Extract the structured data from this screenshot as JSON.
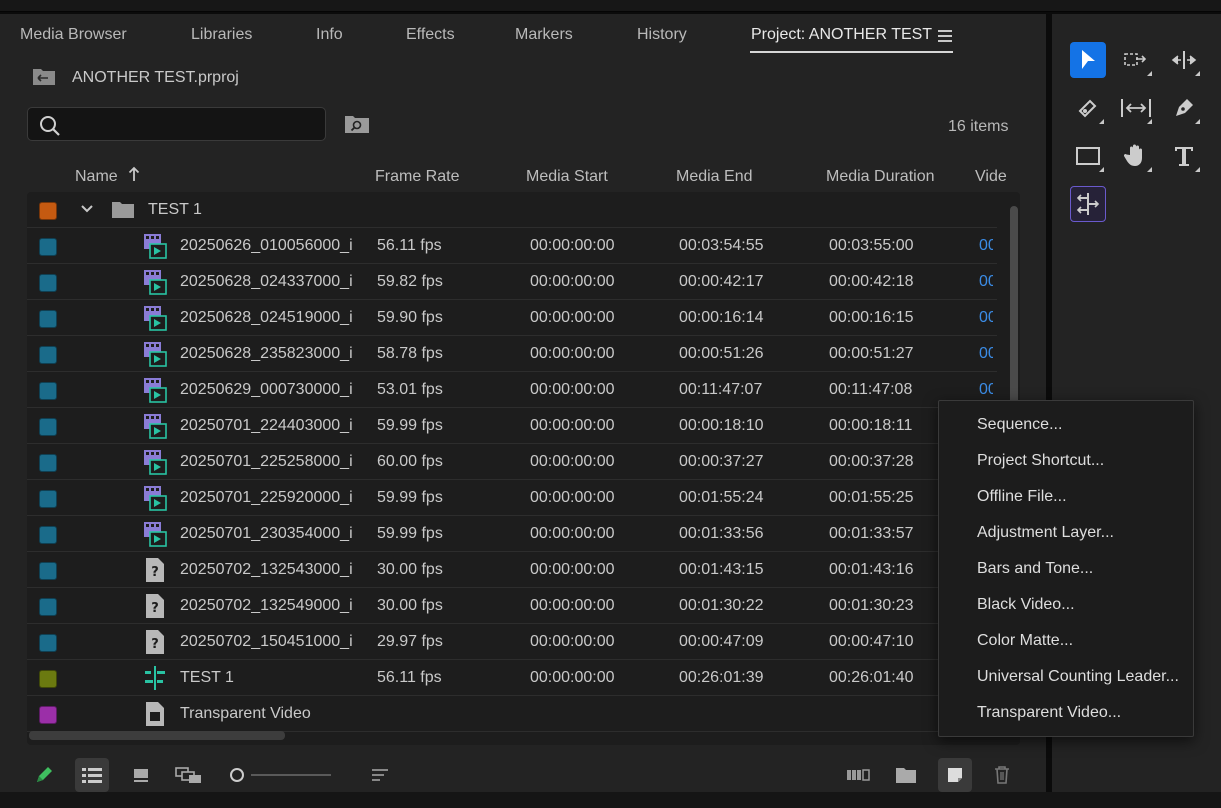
{
  "tabs": [
    "Media Browser",
    "Libraries",
    "Info",
    "Effects",
    "Markers",
    "History",
    "Project: ANOTHER TEST"
  ],
  "active_tab": "Project: ANOTHER TEST",
  "project_file": "ANOTHER TEST.prproj",
  "search": {
    "value": "",
    "placeholder": ""
  },
  "items_count": "16 items",
  "columns": [
    "Name",
    "Frame Rate",
    "Media Start",
    "Media End",
    "Media Duration",
    "Vide"
  ],
  "sort": {
    "column": "Name",
    "direction": "ascending"
  },
  "bin": {
    "name": "TEST 1",
    "label_color": "#c55a11"
  },
  "rows": [
    {
      "name": "20250626_010056000_i",
      "fps": "56.11 fps",
      "start": "00:00:00:00",
      "end": "00:03:54:55",
      "duration": "00:03:55:00",
      "video": "00",
      "icon": "video-clip-icon",
      "label_color": "#1a6b8a"
    },
    {
      "name": "20250628_024337000_i",
      "fps": "59.82 fps",
      "start": "00:00:00:00",
      "end": "00:00:42:17",
      "duration": "00:00:42:18",
      "video": "00",
      "icon": "video-clip-icon",
      "label_color": "#1a6b8a"
    },
    {
      "name": "20250628_024519000_i",
      "fps": "59.90 fps",
      "start": "00:00:00:00",
      "end": "00:00:16:14",
      "duration": "00:00:16:15",
      "video": "00",
      "icon": "video-clip-icon",
      "label_color": "#1a6b8a"
    },
    {
      "name": "20250628_235823000_i",
      "fps": "58.78 fps",
      "start": "00:00:00:00",
      "end": "00:00:51:26",
      "duration": "00:00:51:27",
      "video": "00",
      "icon": "video-clip-icon",
      "label_color": "#1a6b8a"
    },
    {
      "name": "20250629_000730000_i",
      "fps": "53.01 fps",
      "start": "00:00:00:00",
      "end": "00:11:47:07",
      "duration": "00:11:47:08",
      "video": "00",
      "icon": "video-clip-icon",
      "label_color": "#1a6b8a"
    },
    {
      "name": "20250701_224403000_i",
      "fps": "59.99 fps",
      "start": "00:00:00:00",
      "end": "00:00:18:10",
      "duration": "00:00:18:11",
      "video": "",
      "icon": "video-clip-icon",
      "label_color": "#1a6b8a"
    },
    {
      "name": "20250701_225258000_i",
      "fps": "60.00 fps",
      "start": "00:00:00:00",
      "end": "00:00:37:27",
      "duration": "00:00:37:28",
      "video": "",
      "icon": "video-clip-icon",
      "label_color": "#1a6b8a"
    },
    {
      "name": "20250701_225920000_i",
      "fps": "59.99 fps",
      "start": "00:00:00:00",
      "end": "00:01:55:24",
      "duration": "00:01:55:25",
      "video": "",
      "icon": "video-clip-icon",
      "label_color": "#1a6b8a"
    },
    {
      "name": "20250701_230354000_i",
      "fps": "59.99 fps",
      "start": "00:00:00:00",
      "end": "00:01:33:56",
      "duration": "00:01:33:57",
      "video": "",
      "icon": "video-clip-icon",
      "label_color": "#1a6b8a"
    },
    {
      "name": "20250702_132543000_i",
      "fps": "30.00 fps",
      "start": "00:00:00:00",
      "end": "00:01:43:15",
      "duration": "00:01:43:16",
      "video": "",
      "icon": "offline-file-icon",
      "label_color": "#1a6b8a"
    },
    {
      "name": "20250702_132549000_i",
      "fps": "30.00 fps",
      "start": "00:00:00:00",
      "end": "00:01:30:22",
      "duration": "00:01:30:23",
      "video": "",
      "icon": "offline-file-icon",
      "label_color": "#1a6b8a"
    },
    {
      "name": "20250702_150451000_i",
      "fps": "29.97 fps",
      "start": "00:00:00:00",
      "end": "00:00:47:09",
      "duration": "00:00:47:10",
      "video": "",
      "icon": "offline-file-icon",
      "label_color": "#1a6b8a"
    },
    {
      "name": "TEST 1",
      "fps": "56.11 fps",
      "start": "00:00:00:00",
      "end": "00:26:01:39",
      "duration": "00:26:01:40",
      "video": "",
      "icon": "sequence-icon",
      "label_color": "#6b7a10"
    },
    {
      "name": "Transparent Video",
      "fps": "",
      "start": "",
      "end": "",
      "duration": "",
      "video": "",
      "icon": "transparent-video-icon",
      "label_color": "#9b2fa8"
    }
  ],
  "context_menu": [
    "Sequence...",
    "Project Shortcut...",
    "Offline File...",
    "Adjustment Layer...",
    "Bars and Tone...",
    "Black Video...",
    "Color Matte...",
    "Universal Counting Leader...",
    "Transparent Video..."
  ],
  "bottom_toolbar": [
    "pencil-icon",
    "list-view-icon",
    "icon-view-icon",
    "freeform-view-icon",
    "zoom-slider",
    "sort-icons-icon",
    "automate-to-sequence-icon",
    "new-bin-icon",
    "new-item-icon",
    "trash-icon"
  ],
  "tools": [
    "selection-tool-icon",
    "track-select-forward-icon",
    "ripple-edit-icon",
    "razor-icon",
    "slip-icon",
    "pen-icon",
    "rectangle-icon",
    "hand-icon",
    "type-icon",
    "remix-icon"
  ],
  "colors": {
    "accent": "#1473e6",
    "link": "#3b8ce6",
    "panel": "#232323",
    "table": "#1d1d1d"
  }
}
